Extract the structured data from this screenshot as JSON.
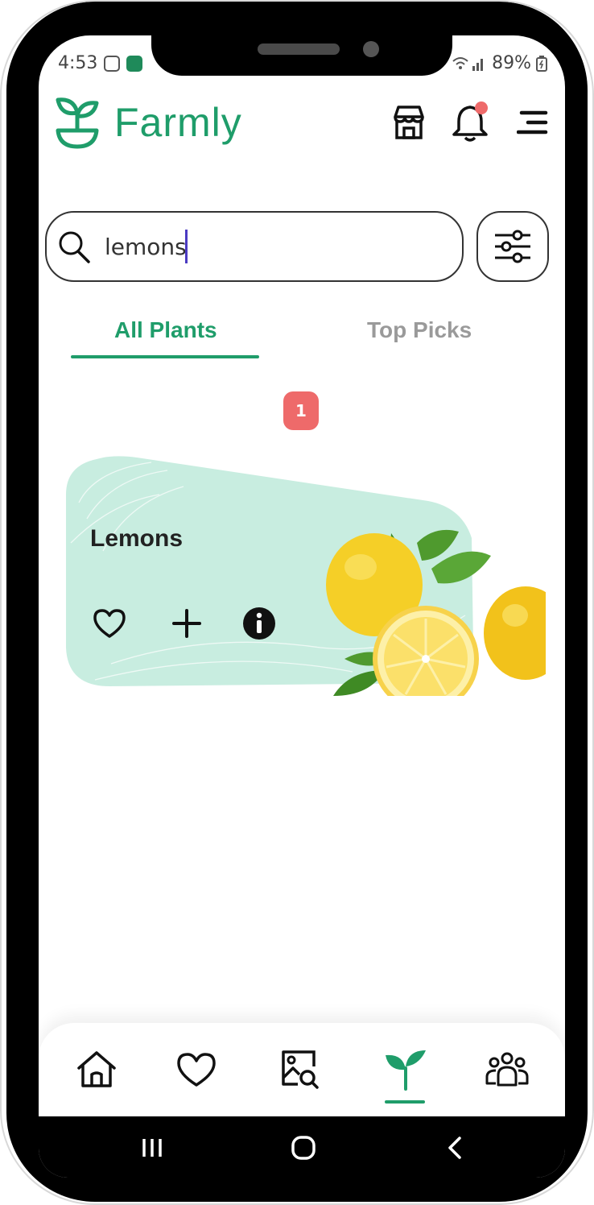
{
  "status_bar": {
    "time": "4:53",
    "battery": "89%"
  },
  "header": {
    "app_name": "Farmly"
  },
  "search": {
    "value": "lemons"
  },
  "tabs": [
    {
      "label": "All Plants",
      "active": true
    },
    {
      "label": "Top Picks",
      "active": false
    }
  ],
  "results_count": "1",
  "plant_card": {
    "name": "Lemons"
  },
  "colors": {
    "brand_green": "#1f9d6a",
    "card_mint": "#c8ede0",
    "badge_red": "#ee6a6a"
  },
  "icons": {
    "header": [
      "store-icon",
      "bell-icon",
      "menu-icon"
    ],
    "card_actions": [
      "heart-icon",
      "plus-icon",
      "info-icon"
    ],
    "bottom_nav": [
      "home-icon",
      "heart-icon",
      "image-search-icon",
      "sprout-icon",
      "community-icon"
    ],
    "system_nav": [
      "recents-icon",
      "home-circle-icon",
      "back-icon"
    ]
  },
  "bottom_nav": {
    "active_index": 3
  }
}
